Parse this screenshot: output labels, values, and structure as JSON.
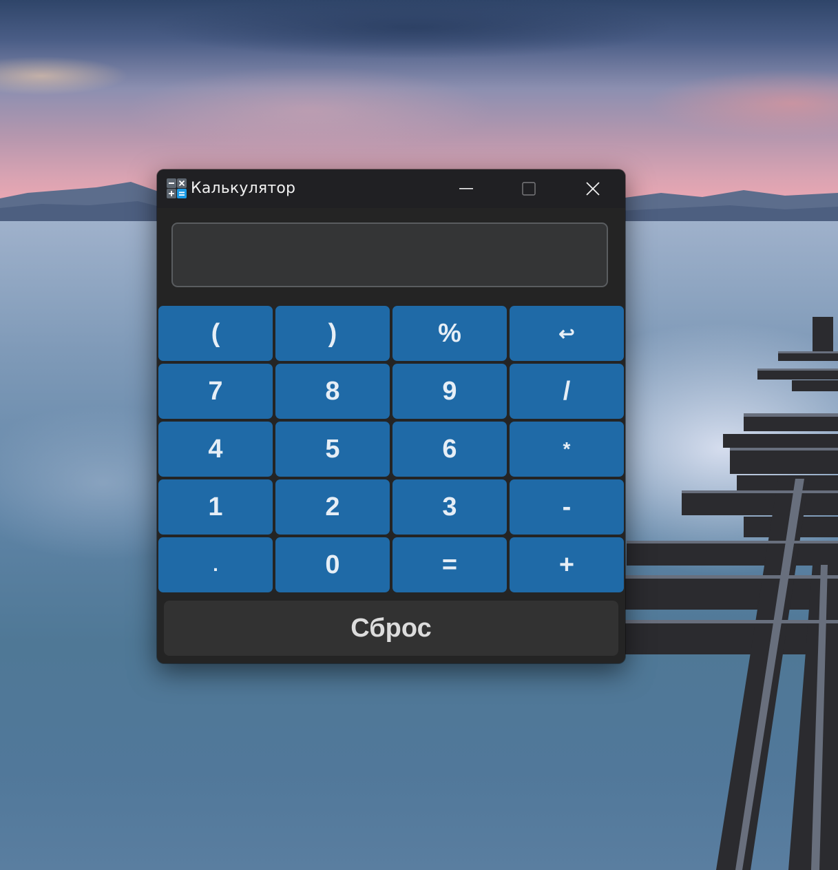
{
  "window": {
    "title": "Калькулятор",
    "controls": {
      "minimize": "minimize",
      "maximize": "maximize",
      "close": "close"
    }
  },
  "display": {
    "value": ""
  },
  "keys": [
    {
      "label": "(",
      "name": "open-paren"
    },
    {
      "label": ")",
      "name": "close-paren"
    },
    {
      "label": "%",
      "name": "percent"
    },
    {
      "label": "↩",
      "name": "backspace"
    },
    {
      "label": "7",
      "name": "digit-7"
    },
    {
      "label": "8",
      "name": "digit-8"
    },
    {
      "label": "9",
      "name": "digit-9"
    },
    {
      "label": "/",
      "name": "divide"
    },
    {
      "label": "4",
      "name": "digit-4"
    },
    {
      "label": "5",
      "name": "digit-5"
    },
    {
      "label": "6",
      "name": "digit-6"
    },
    {
      "label": "*",
      "name": "multiply"
    },
    {
      "label": "1",
      "name": "digit-1"
    },
    {
      "label": "2",
      "name": "digit-2"
    },
    {
      "label": "3",
      "name": "digit-3"
    },
    {
      "label": "-",
      "name": "subtract"
    },
    {
      "label": ".",
      "name": "decimal"
    },
    {
      "label": "0",
      "name": "digit-0"
    },
    {
      "label": "=",
      "name": "equals"
    },
    {
      "label": "+",
      "name": "add"
    }
  ],
  "reset_label": "Сброс",
  "colors": {
    "key_blue": "#1f6aa7",
    "window_bg": "#242424",
    "titlebar_bg": "#202023",
    "display_bg": "#343536",
    "reset_bg": "#323232"
  }
}
